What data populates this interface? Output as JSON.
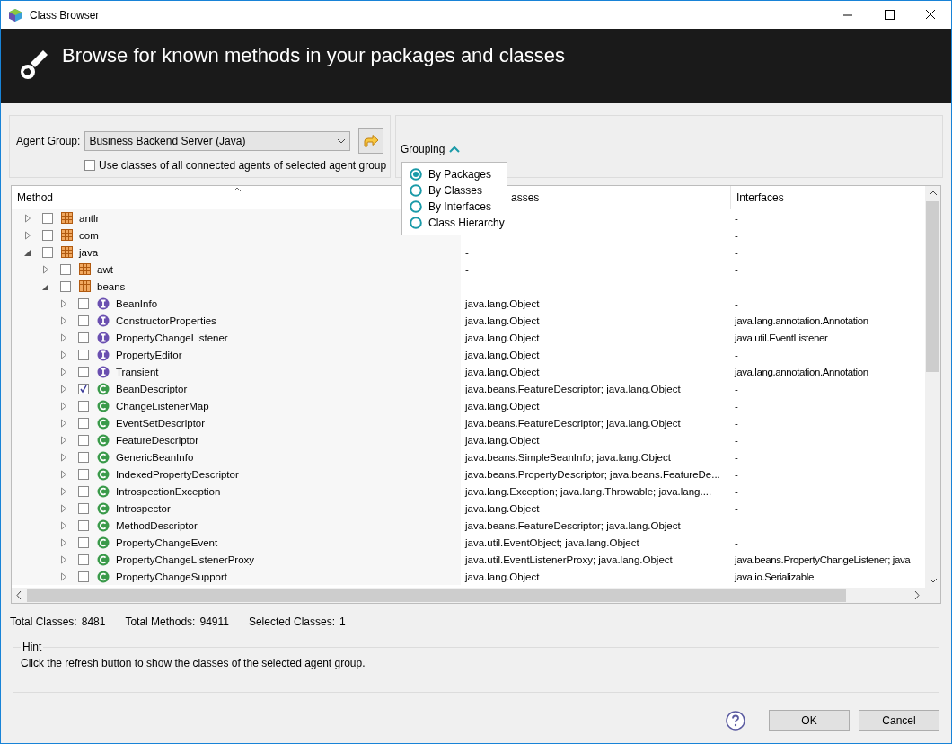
{
  "window": {
    "title": "Class Browser"
  },
  "banner": {
    "title": "Browse for known methods in your packages and classes"
  },
  "agent_group": {
    "label": "Agent Group:",
    "value": "Business Backend Server (Java)",
    "all_agents": {
      "label": "Use classes of all connected agents of selected agent group",
      "checked": false
    }
  },
  "grouping": {
    "label": "Grouping",
    "expanded": true,
    "options": [
      {
        "label": "By Packages",
        "selected": true
      },
      {
        "label": "By Classes",
        "selected": false
      },
      {
        "label": "By Interfaces",
        "selected": false
      },
      {
        "label": "Class Hierarchy",
        "selected": false
      }
    ]
  },
  "table": {
    "columns": [
      "Method",
      "asses",
      "Interfaces"
    ],
    "rows": [
      {
        "name": "antlr",
        "kind": "package",
        "checked": false,
        "expanded": false,
        "interfaces": "-"
      },
      {
        "name": "com",
        "kind": "package",
        "checked": false,
        "expanded": false,
        "interfaces": "-"
      },
      {
        "name": "java",
        "kind": "package",
        "checked": false,
        "expanded": true,
        "superclasses": "-",
        "interfaces": "-",
        "children": [
          {
            "name": "awt",
            "kind": "package",
            "checked": false,
            "expanded": false,
            "superclasses": "-",
            "interfaces": "-"
          },
          {
            "name": "beans",
            "kind": "package",
            "checked": false,
            "expanded": true,
            "superclasses": "-",
            "interfaces": "-",
            "children": [
              {
                "name": "BeanInfo",
                "kind": "interface",
                "checked": false,
                "expanded": false,
                "superclasses": "java.lang.Object",
                "interfaces": "-"
              },
              {
                "name": "ConstructorProperties",
                "kind": "interface",
                "checked": false,
                "expanded": false,
                "superclasses": "java.lang.Object",
                "interfaces": "java.lang.annotation.Annotation"
              },
              {
                "name": "PropertyChangeListener",
                "kind": "interface",
                "checked": false,
                "expanded": false,
                "superclasses": "java.lang.Object",
                "interfaces": "java.util.EventListener"
              },
              {
                "name": "PropertyEditor",
                "kind": "interface",
                "checked": false,
                "expanded": false,
                "superclasses": "java.lang.Object",
                "interfaces": "-"
              },
              {
                "name": "Transient",
                "kind": "interface",
                "checked": false,
                "expanded": false,
                "superclasses": "java.lang.Object",
                "interfaces": "java.lang.annotation.Annotation"
              },
              {
                "name": "BeanDescriptor",
                "kind": "class",
                "checked": true,
                "expanded": false,
                "superclasses": "java.beans.FeatureDescriptor; java.lang.Object",
                "interfaces": "-"
              },
              {
                "name": "ChangeListenerMap",
                "kind": "class",
                "checked": false,
                "expanded": false,
                "superclasses": "java.lang.Object",
                "interfaces": "-"
              },
              {
                "name": "EventSetDescriptor",
                "kind": "class",
                "checked": false,
                "expanded": false,
                "superclasses": "java.beans.FeatureDescriptor; java.lang.Object",
                "interfaces": "-"
              },
              {
                "name": "FeatureDescriptor",
                "kind": "class",
                "checked": false,
                "expanded": false,
                "superclasses": "java.lang.Object",
                "interfaces": "-"
              },
              {
                "name": "GenericBeanInfo",
                "kind": "class",
                "checked": false,
                "expanded": false,
                "superclasses": "java.beans.SimpleBeanInfo; java.lang.Object",
                "interfaces": "-"
              },
              {
                "name": "IndexedPropertyDescriptor",
                "kind": "class",
                "checked": false,
                "expanded": false,
                "superclasses": "java.beans.PropertyDescriptor; java.beans.FeatureDe...",
                "interfaces": "-"
              },
              {
                "name": "IntrospectionException",
                "kind": "class",
                "checked": false,
                "expanded": false,
                "superclasses": "java.lang.Exception; java.lang.Throwable; java.lang....",
                "interfaces": "-"
              },
              {
                "name": "Introspector",
                "kind": "class",
                "checked": false,
                "expanded": false,
                "superclasses": "java.lang.Object",
                "interfaces": "-"
              },
              {
                "name": "MethodDescriptor",
                "kind": "class",
                "checked": false,
                "expanded": false,
                "superclasses": "java.beans.FeatureDescriptor; java.lang.Object",
                "interfaces": "-"
              },
              {
                "name": "PropertyChangeEvent",
                "kind": "class",
                "checked": false,
                "expanded": false,
                "superclasses": "java.util.EventObject; java.lang.Object",
                "interfaces": "-"
              },
              {
                "name": "PropertyChangeListenerProxy",
                "kind": "class",
                "checked": false,
                "expanded": false,
                "superclasses": "java.util.EventListenerProxy; java.lang.Object",
                "interfaces": "java.beans.PropertyChangeListener; java"
              },
              {
                "name": "PropertyChangeSupport",
                "kind": "class",
                "checked": false,
                "expanded": false,
                "superclasses": "java.lang.Object",
                "interfaces": "java.io.Serializable"
              }
            ]
          }
        ]
      }
    ]
  },
  "status": [
    {
      "label": "Total Classes:",
      "value": "8481"
    },
    {
      "label": "Total Methods:",
      "value": "94911"
    },
    {
      "label": "Selected Classes:",
      "value": "1"
    }
  ],
  "hint": {
    "title": "Hint",
    "text": "Click the refresh button to show the classes of the selected agent group."
  },
  "buttons": [
    "OK",
    "Cancel"
  ]
}
